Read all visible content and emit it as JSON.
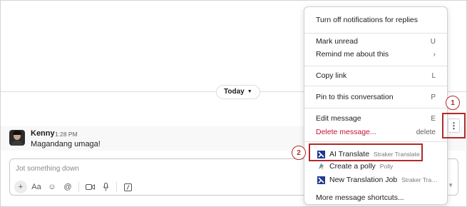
{
  "divider": {
    "label": "Today"
  },
  "message": {
    "sender": "Kenny",
    "time": "1:28 PM",
    "text": "Magandang umaga!"
  },
  "composer": {
    "placeholder": "Jot something down",
    "tools": [
      "plus-icon",
      "text-format-icon",
      "emoji-icon",
      "mention-icon",
      "video-icon",
      "microphone-icon",
      "slash-command-icon"
    ],
    "format_label": "Aa"
  },
  "menu": {
    "turn_off": "Turn off notifications for replies",
    "mark_unread": {
      "label": "Mark unread",
      "shortcut": "U"
    },
    "remind": {
      "label": "Remind me about this",
      "shortcut": "›"
    },
    "copy_link": {
      "label": "Copy link",
      "shortcut": "L"
    },
    "pin": {
      "label": "Pin to this conversation",
      "shortcut": "P"
    },
    "edit": {
      "label": "Edit message",
      "shortcut": "E"
    },
    "delete": {
      "label": "Delete message...",
      "shortcut": "delete"
    },
    "apps": [
      {
        "name": "AI Translate",
        "sub": "Straker Translate"
      },
      {
        "name": "Create a polly",
        "sub": "Polly"
      },
      {
        "name": "New Translation Job",
        "sub": "Straker Transl..."
      }
    ],
    "more": "More message shortcuts..."
  },
  "annotations": {
    "step1": "1",
    "step2": "2"
  },
  "colors": {
    "highlight": "#b22a2a",
    "danger": "#c0123e"
  }
}
